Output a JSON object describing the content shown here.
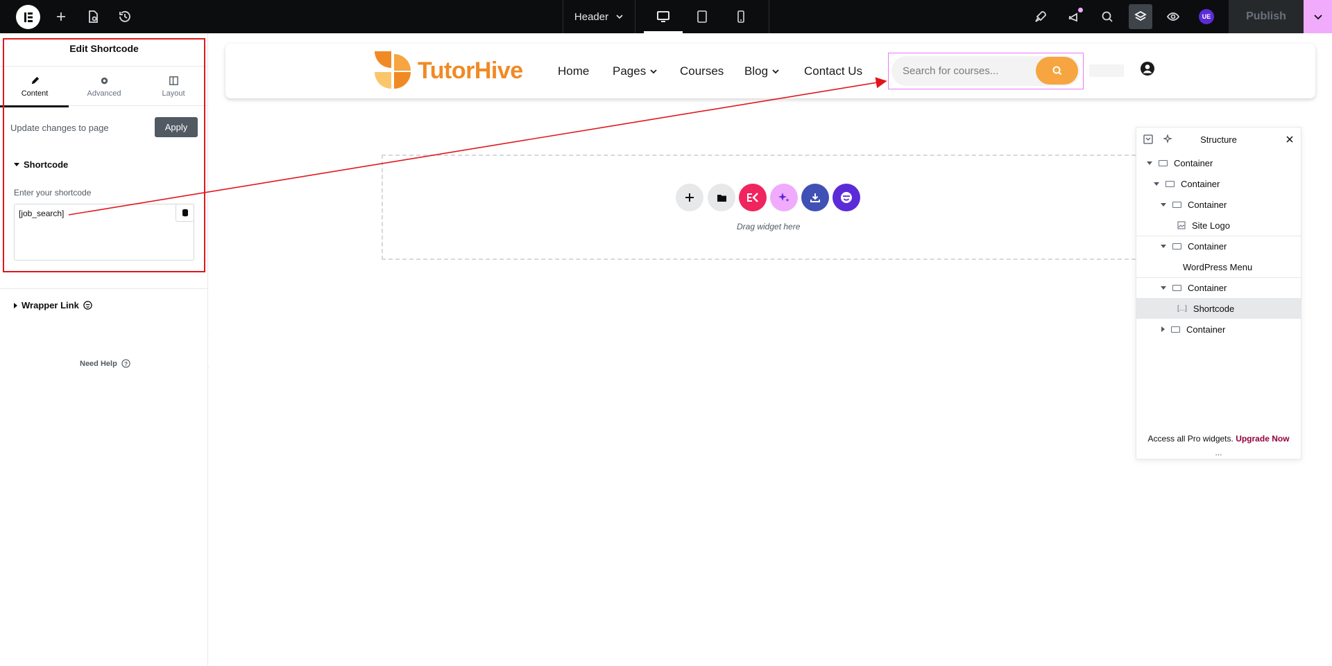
{
  "topbar": {
    "document_name": "Header",
    "publish_label": "Publish",
    "user_initials": "UE"
  },
  "panel": {
    "title": "Edit Shortcode",
    "tabs": [
      {
        "label": "Content",
        "icon": "pencil-icon"
      },
      {
        "label": "Advanced",
        "icon": "gear-icon"
      },
      {
        "label": "Layout",
        "icon": "layout-icon"
      }
    ],
    "update_label": "Update changes to page",
    "apply_label": "Apply",
    "shortcode_section": "Shortcode",
    "shortcode_field_label": "Enter your shortcode",
    "shortcode_value": "[job_search]",
    "wrapper_section": "Wrapper Link",
    "need_help": "Need Help"
  },
  "site_header": {
    "logo_text": "TutorHive",
    "nav": [
      {
        "label": "Home",
        "has_dropdown": false
      },
      {
        "label": "Pages",
        "has_dropdown": true
      },
      {
        "label": "Courses",
        "has_dropdown": false
      },
      {
        "label": "Blog",
        "has_dropdown": true
      },
      {
        "label": "Contact Us",
        "has_dropdown": false
      }
    ],
    "search_placeholder": "Search for courses...",
    "brand_color": "#f08a24",
    "search_button_color": "#f6a541"
  },
  "drop_zone": {
    "text": "Drag widget here",
    "buttons": [
      {
        "icon": "plus-icon",
        "color": "#e6e8ea"
      },
      {
        "icon": "folder-icon",
        "color": "#e6e8ea"
      },
      {
        "icon": "elementskit-icon",
        "color": "#f0245e"
      },
      {
        "icon": "ai-sparkle-icon",
        "color": "#f0abfc"
      },
      {
        "icon": "download-icon",
        "color": "#3f51b5"
      },
      {
        "icon": "smiley-icon",
        "color": "#5b2bd8"
      }
    ]
  },
  "structure": {
    "title": "Structure",
    "items": [
      {
        "label": "Container",
        "indent": 0,
        "caret": "down",
        "icon": "container-icon"
      },
      {
        "label": "Container",
        "indent": 1,
        "caret": "down",
        "icon": "container-icon"
      },
      {
        "label": "Container",
        "indent": 2,
        "caret": "down",
        "icon": "container-icon"
      },
      {
        "label": "Site Logo",
        "indent": 3,
        "caret": "none",
        "icon": "image-icon"
      },
      {
        "label": "Container",
        "indent": 2,
        "caret": "down",
        "icon": "container-icon"
      },
      {
        "label": "WordPress Menu",
        "indent": 3,
        "caret": "none",
        "icon": "none"
      },
      {
        "label": "Container",
        "indent": 2,
        "caret": "down",
        "icon": "container-icon"
      },
      {
        "label": "Shortcode",
        "indent": 3,
        "caret": "none",
        "icon": "shortcode-icon",
        "selected": true
      },
      {
        "label": "Container",
        "indent": 2,
        "caret": "right",
        "icon": "container-icon"
      }
    ],
    "footer_text": "Access all Pro widgets.",
    "footer_link": "Upgrade Now",
    "grip": "..."
  }
}
